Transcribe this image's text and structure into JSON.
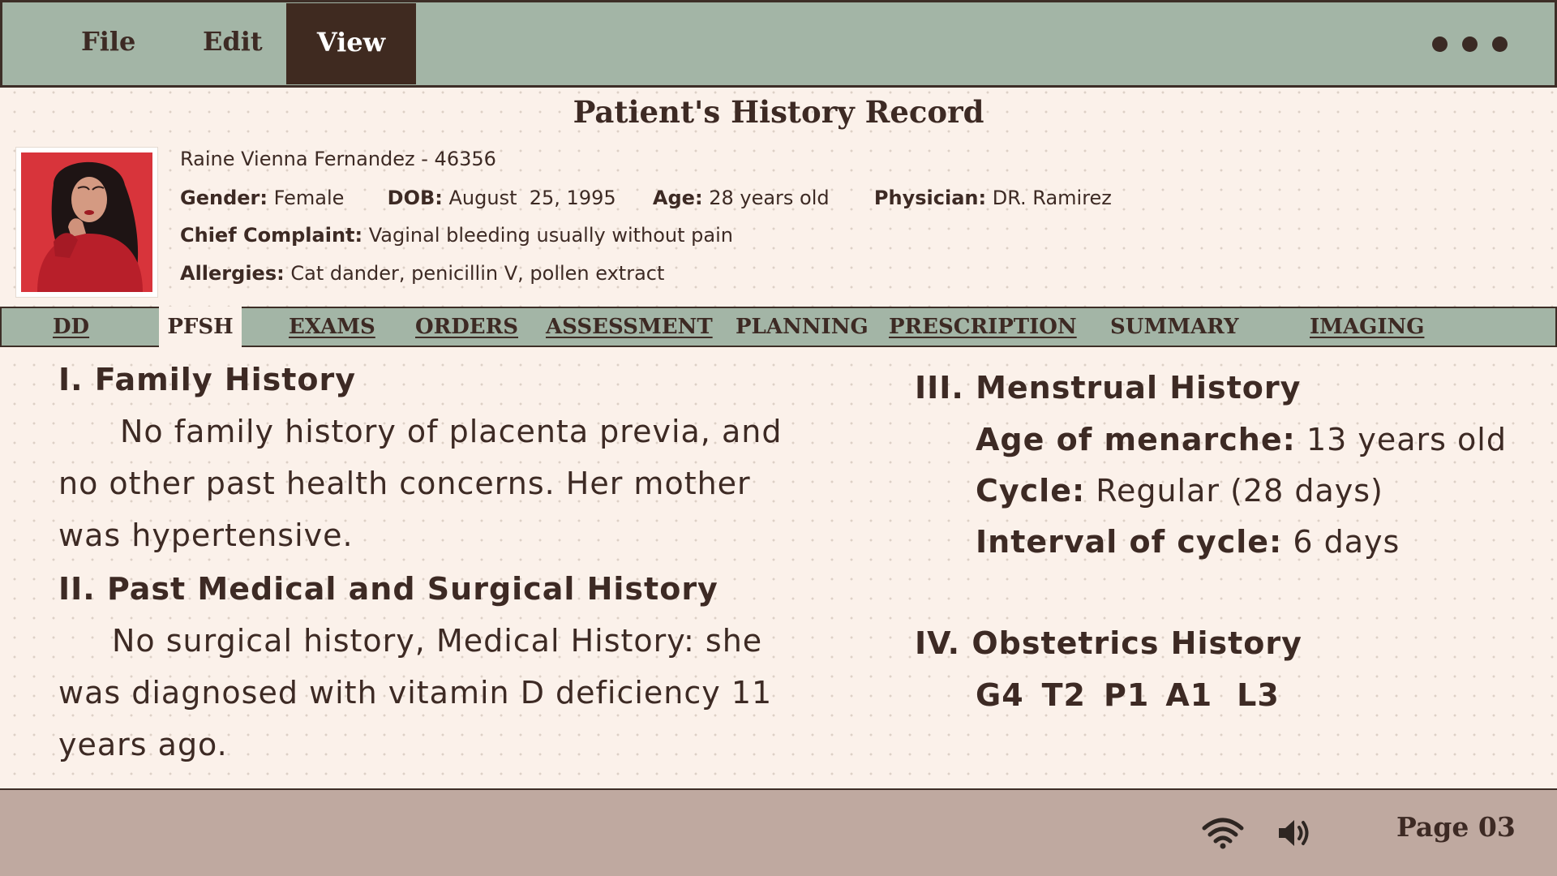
{
  "menu": {
    "file": "File",
    "edit": "Edit",
    "view": "View"
  },
  "title": "Patient's History Record",
  "patient": {
    "name_line": "Raine Vienna Fernandez - 46356",
    "gender_label": "Gender:",
    "gender": "Female",
    "dob_label": "DOB:",
    "dob": "August  25, 1995",
    "age_label": "Age:",
    "age": "28 years old",
    "physician_label": "Physician:",
    "physician": "DR. Ramirez",
    "complaint_label": "Chief Complaint:",
    "complaint": "Vaginal bleeding usually without pain",
    "allergies_label": "Allergies:",
    "allergies": "Cat dander, penicillin V, pollen extract"
  },
  "tabs": [
    "DD",
    "PFSH",
    "EXAMS",
    "ORDERS",
    "ASSESSMENT",
    "PLANNING",
    "PRESCRIPTION",
    "SUMMARY",
    "IMAGING"
  ],
  "active_tab": "PFSH",
  "family": {
    "heading": "I. Family History",
    "lines": [
      "No family history of placenta previa, and",
      "no other past health concerns. Her mother",
      "was hypertensive."
    ]
  },
  "past": {
    "heading": "II. Past Medical and Surgical History",
    "lines": [
      "No surgical history, Medical History: she",
      "was diagnosed with vitamin D deficiency 11",
      "years ago."
    ]
  },
  "menstrual": {
    "heading": "III. Menstrual History",
    "menarche_label": "Age of menarche:",
    "menarche": "13 years old",
    "cycle_label": "Cycle:",
    "cycle": "Regular (28 days)",
    "interval_label": "Interval of cycle:",
    "interval": "6 days"
  },
  "obstetrics": {
    "heading": "IV. Obstetrics History",
    "values": [
      "G4",
      "T2",
      "P1",
      "A1",
      "L3"
    ]
  },
  "footer": {
    "page": "Page 03"
  },
  "icons": {
    "more": "more-dots-icon",
    "wifi": "wifi-icon",
    "volume": "volume-icon"
  },
  "colors": {
    "bar": "#a3b5a6",
    "footer": "#bfa9a0",
    "active_menu": "#3f2a20",
    "background": "#fbf1ea",
    "text": "#3d2a24"
  }
}
